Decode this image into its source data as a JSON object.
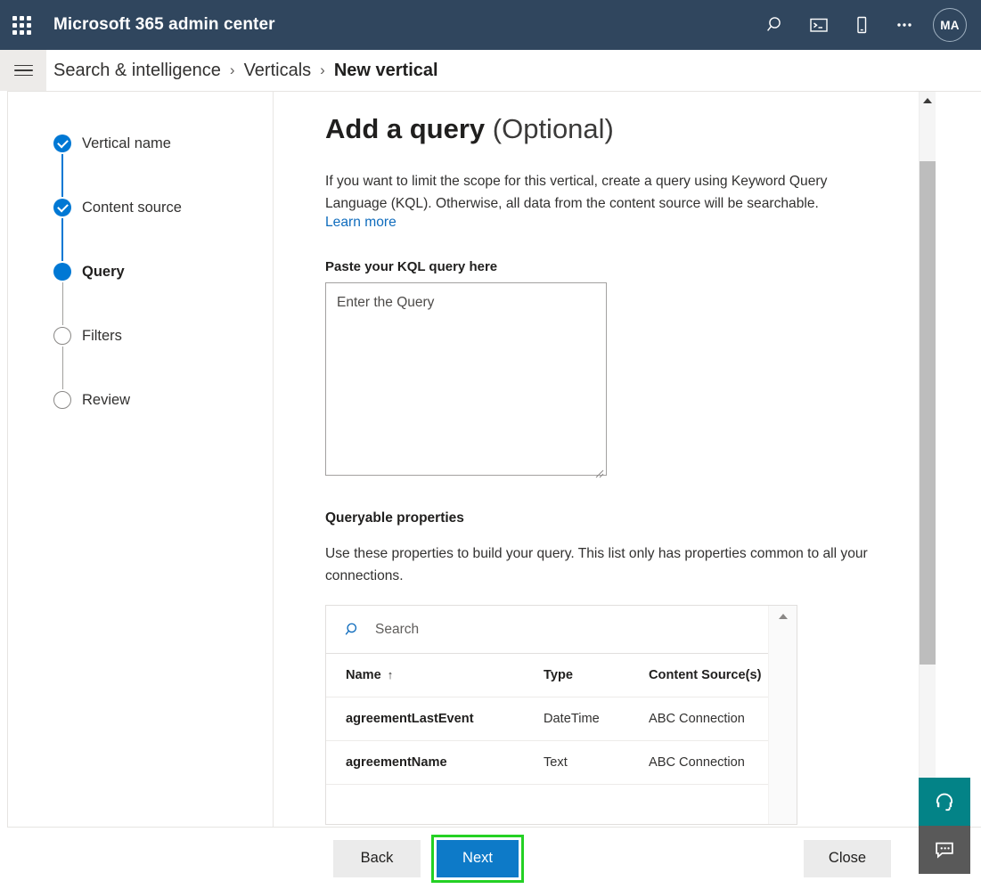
{
  "suite": {
    "waffle_icon": "app-launcher-waffle-icon",
    "title": "Microsoft 365 admin center",
    "actions": [
      {
        "name": "search-icon",
        "label": "Search"
      },
      {
        "name": "console-icon",
        "label": "Console"
      },
      {
        "name": "mobile-icon",
        "label": "Mobile"
      },
      {
        "name": "more-icon",
        "label": "More"
      }
    ],
    "avatar_initials": "MA"
  },
  "breadcrumb": {
    "hamburger_icon": "hamburger-menu-icon",
    "separator": "›",
    "items": [
      {
        "label": "Search & intelligence",
        "current": false
      },
      {
        "label": "Verticals",
        "current": false
      },
      {
        "label": "New vertical",
        "current": true
      }
    ]
  },
  "wizard": {
    "steps": [
      {
        "label": "Vertical name",
        "state": "done"
      },
      {
        "label": "Content source",
        "state": "done"
      },
      {
        "label": "Query",
        "state": "active"
      },
      {
        "label": "Filters",
        "state": "todo"
      },
      {
        "label": "Review",
        "state": "todo"
      }
    ]
  },
  "main": {
    "title_strong": "Add a query",
    "title_light": " (Optional)",
    "description": "If you want to limit the scope for this vertical, create a query using Keyword Query Language (KQL). Otherwise, all data from the content source will be searchable.",
    "learn_more": "Learn more",
    "kql_label": "Paste your KQL query here",
    "kql_value": "",
    "kql_placeholder": "Enter the Query",
    "properties_heading": "Queryable properties",
    "properties_description": "Use these properties to build your query. This list only has properties common to all your connections.",
    "search": {
      "icon": "search-icon",
      "value": "",
      "placeholder": "Search"
    },
    "table": {
      "columns": [
        "Name",
        "Type",
        "Content Source(s)"
      ],
      "sort_column": "Name",
      "sort_arrow": "↑",
      "rows": [
        {
          "name": "agreementLastEvent",
          "type": "DateTime",
          "source": "ABC Connection"
        },
        {
          "name": "agreementName",
          "type": "Text",
          "source": "ABC Connection"
        }
      ]
    }
  },
  "footer": {
    "back_label": "Back",
    "next_label": "Next",
    "close_label": "Close"
  },
  "float": {
    "support_icon": "headset-icon",
    "feedback_icon": "feedback-chat-icon"
  },
  "colors": {
    "suite_bar": "#30465e",
    "accent_blue": "#0078d4",
    "primary_button": "#0d7ac8",
    "link": "#0f6cbd",
    "highlight_outline": "#24d124",
    "support_teal": "#038387",
    "feedback_gray": "#595959"
  }
}
